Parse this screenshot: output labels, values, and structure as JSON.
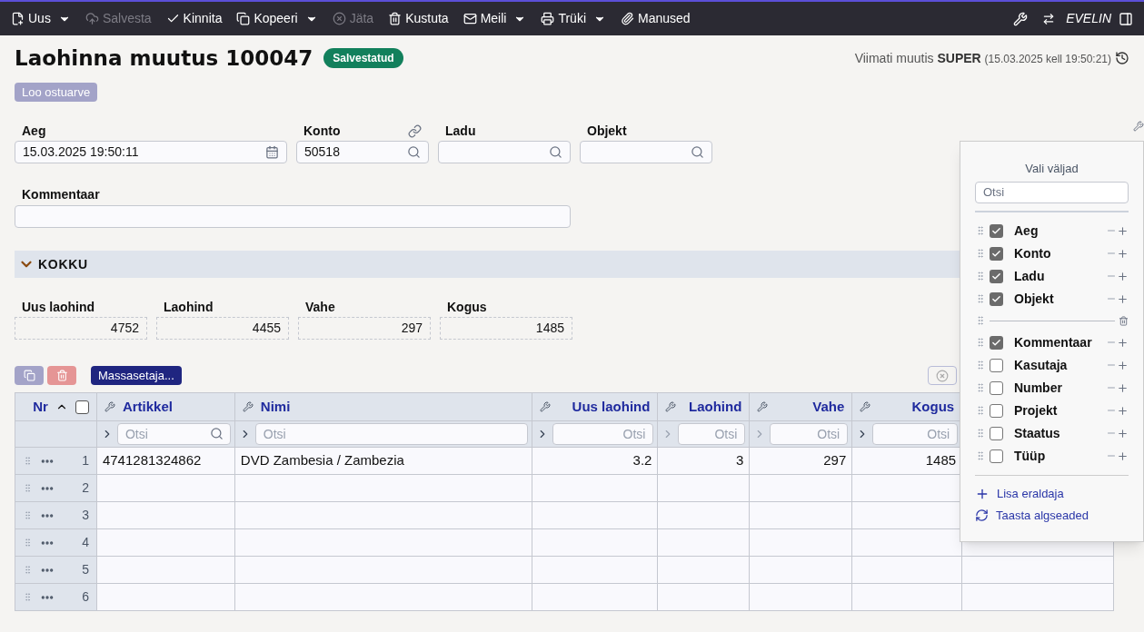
{
  "toolbar": {
    "items": [
      {
        "label": "Uus",
        "disabled": false,
        "dropdown": true
      },
      {
        "label": "Salvesta",
        "disabled": true,
        "dropdown": false
      },
      {
        "label": "Kinnita",
        "disabled": false,
        "dropdown": false
      },
      {
        "label": "Kopeeri",
        "disabled": false,
        "dropdown": true
      },
      {
        "label": "Jäta",
        "disabled": true,
        "dropdown": false
      },
      {
        "label": "Kustuta",
        "disabled": false,
        "dropdown": false
      },
      {
        "label": "Meili",
        "disabled": false,
        "dropdown": true
      },
      {
        "label": "Trüki",
        "disabled": false,
        "dropdown": true
      },
      {
        "label": "Manused",
        "disabled": false,
        "dropdown": false
      }
    ],
    "user": "EVELIN"
  },
  "header": {
    "title": "Laohinna muutus 100047",
    "status": "Salvestatud",
    "modified_prefix": "Viimati muutis",
    "modified_user": "SUPER",
    "modified_time": "(15.03.2025 kell 19:50:21)"
  },
  "action_button": {
    "label": "Loo ostuarve",
    "disabled": true
  },
  "fields": [
    {
      "label": "Aeg",
      "value": "15.03.2025 19:50:11",
      "kind": "date",
      "link": false
    },
    {
      "label": "Konto",
      "value": "50518",
      "kind": "search",
      "link": true
    },
    {
      "label": "Ladu",
      "kind": "search",
      "link": false
    },
    {
      "label": "Objekt",
      "kind": "search",
      "link": false
    }
  ],
  "comment": {
    "label": "Kommentaar"
  },
  "summary": {
    "title": "KOKKU",
    "expanded": true,
    "items": [
      {
        "label": "Uus laohind",
        "value": "4752"
      },
      {
        "label": "Laohind",
        "value": "4455"
      },
      {
        "label": "Vahe",
        "value": "297"
      },
      {
        "label": "Kogus",
        "value": "1485"
      }
    ]
  },
  "table_toolbar": {
    "mass_button": "Massasetaja..."
  },
  "table": {
    "nr_label": "Nr",
    "select_all_checked": false,
    "columns": [
      {
        "name": "Artikkel",
        "placeholder": "Otsi",
        "filter_disabled": false
      },
      {
        "name": "Nimi",
        "placeholder": "Otsi",
        "filter_disabled": false
      },
      {
        "name": "Uus laohind",
        "placeholder": "Otsi",
        "filter_disabled": false
      },
      {
        "name": "Laohind",
        "placeholder": "Otsi",
        "filter_disabled": true
      },
      {
        "name": "Vahe",
        "placeholder": "Otsi",
        "filter_disabled": true
      },
      {
        "name": "Kogus",
        "placeholder": "Otsi",
        "filter_disabled": false
      }
    ],
    "rows": [
      {
        "nr": "1",
        "cells": [
          "4741281324862",
          "DVD Zambesia / Zambezia",
          "3.2",
          "3",
          "297",
          "1485"
        ]
      },
      {
        "nr": "2"
      },
      {
        "nr": "3"
      },
      {
        "nr": "4"
      },
      {
        "nr": "5"
      },
      {
        "nr": "6"
      }
    ]
  },
  "field_picker": {
    "title": "Vali väljad",
    "placeholder": "Otsi",
    "items": [
      {
        "kind": "field",
        "label": "Aeg",
        "checked": true
      },
      {
        "kind": "field",
        "label": "Konto",
        "checked": true
      },
      {
        "kind": "field",
        "label": "Ladu",
        "checked": true
      },
      {
        "kind": "field",
        "label": "Objekt",
        "checked": true
      },
      {
        "kind": "separator"
      },
      {
        "kind": "field",
        "label": "Kommentaar",
        "checked": true
      },
      {
        "kind": "field",
        "label": "Kasutaja",
        "checked": false
      },
      {
        "kind": "field",
        "label": "Number",
        "checked": false
      },
      {
        "kind": "field",
        "label": "Projekt",
        "checked": false
      },
      {
        "kind": "field",
        "label": "Staatus",
        "checked": false
      },
      {
        "kind": "field",
        "label": "Tüüp",
        "checked": false
      }
    ],
    "add_separator": "Lisa eraldaja",
    "reset": "Taasta algseaded"
  }
}
